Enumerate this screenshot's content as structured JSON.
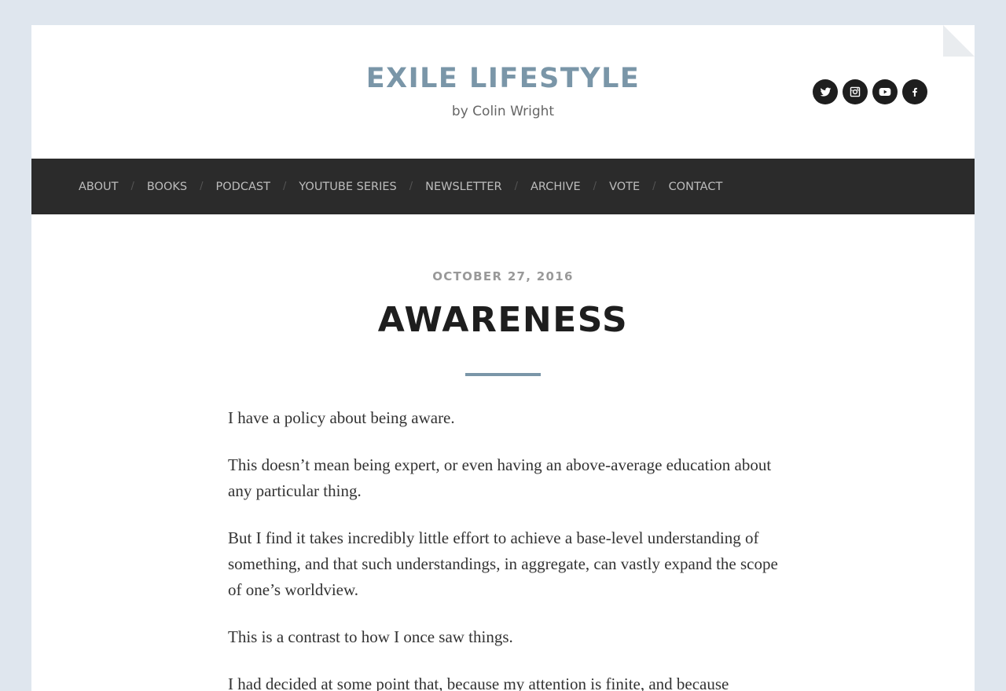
{
  "site": {
    "title": "EXILE LIFESTYLE",
    "tagline": "by Colin Wright"
  },
  "social": [
    {
      "name": "twitter-icon",
      "label": "Twitter"
    },
    {
      "name": "instagram-icon",
      "label": "Instagram"
    },
    {
      "name": "youtube-icon",
      "label": "YouTube"
    },
    {
      "name": "facebook-icon",
      "label": "Facebook"
    }
  ],
  "nav": {
    "items": [
      {
        "label": "ABOUT"
      },
      {
        "label": "BOOKS"
      },
      {
        "label": "PODCAST"
      },
      {
        "label": "YOUTUBE SERIES"
      },
      {
        "label": "NEWSLETTER"
      },
      {
        "label": "ARCHIVE"
      },
      {
        "label": "VOTE"
      },
      {
        "label": "CONTACT"
      }
    ],
    "separator": "/"
  },
  "post": {
    "date": "OCTOBER 27, 2016",
    "title": "AWARENESS",
    "paragraphs": [
      "I have a policy about being aware.",
      "This doesn’t mean being expert, or even having an above-average education about any particular thing.",
      "But I find it takes incredibly little effort to achieve a base-level understanding of something, and that such understandings, in aggregate, can vastly expand the scope of one’s worldview.",
      "This is a contrast to how I once saw things.",
      "I had decided at some point that, because my attention is finite, and because"
    ]
  },
  "colors": {
    "background": "#dfe6ee",
    "accent": "#7a96a8",
    "nav_background": "#2b2b2b",
    "nav_text": "#bdbdbd",
    "title_text": "#1e1e1e"
  }
}
